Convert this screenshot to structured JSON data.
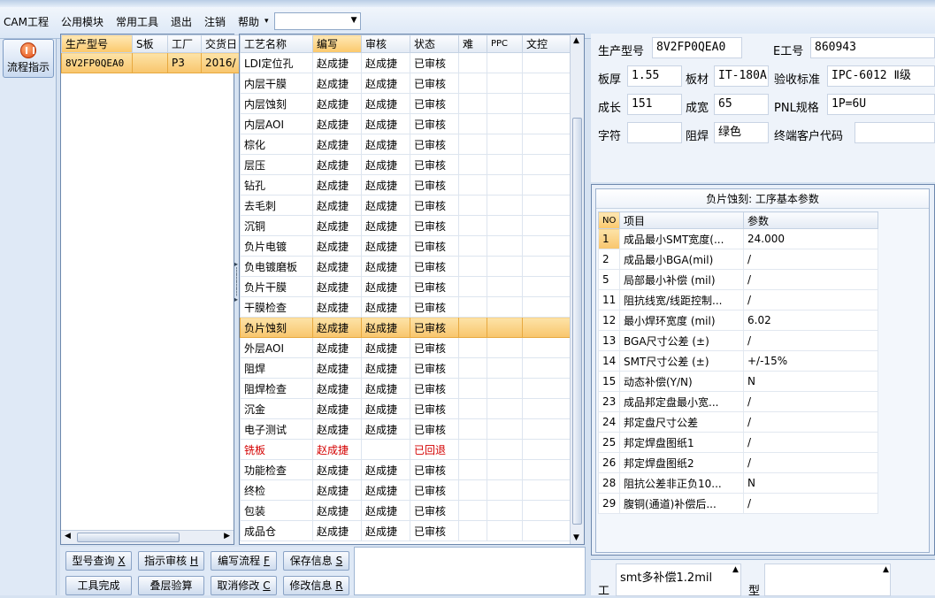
{
  "menu": {
    "items": [
      "CAM工程",
      "公用模块",
      "常用工具",
      "退出",
      "注销",
      "帮助"
    ],
    "help_arrow": "▾",
    "combo_value": ""
  },
  "sidebar": {
    "flow_button": "流程指示"
  },
  "orders": {
    "columns": [
      "生产型号",
      "S板",
      "工厂",
      "交货日"
    ],
    "rows": [
      {
        "model": "8V2FP0QEA0",
        "s": "",
        "factory": "P3",
        "date": "2016/"
      }
    ]
  },
  "process": {
    "columns": [
      "工艺名称",
      "编写",
      "审核",
      "状态",
      "难",
      "PPC",
      "文控"
    ],
    "rows": [
      {
        "name": "LDI定位孔",
        "writer": "赵成捷",
        "reviewer": "赵成捷",
        "status": "已审核"
      },
      {
        "name": "内层干膜",
        "writer": "赵成捷",
        "reviewer": "赵成捷",
        "status": "已审核"
      },
      {
        "name": "内层蚀刻",
        "writer": "赵成捷",
        "reviewer": "赵成捷",
        "status": "已审核"
      },
      {
        "name": "内层AOI",
        "writer": "赵成捷",
        "reviewer": "赵成捷",
        "status": "已审核"
      },
      {
        "name": "棕化",
        "writer": "赵成捷",
        "reviewer": "赵成捷",
        "status": "已审核"
      },
      {
        "name": "层压",
        "writer": "赵成捷",
        "reviewer": "赵成捷",
        "status": "已审核"
      },
      {
        "name": "钻孔",
        "writer": "赵成捷",
        "reviewer": "赵成捷",
        "status": "已审核"
      },
      {
        "name": "去毛刺",
        "writer": "赵成捷",
        "reviewer": "赵成捷",
        "status": "已审核"
      },
      {
        "name": "沉铜",
        "writer": "赵成捷",
        "reviewer": "赵成捷",
        "status": "已审核"
      },
      {
        "name": "负片电镀",
        "writer": "赵成捷",
        "reviewer": "赵成捷",
        "status": "已审核"
      },
      {
        "name": "负电镀磨板",
        "writer": "赵成捷",
        "reviewer": "赵成捷",
        "status": "已审核"
      },
      {
        "name": "负片干膜",
        "writer": "赵成捷",
        "reviewer": "赵成捷",
        "status": "已审核"
      },
      {
        "name": "干膜检查",
        "writer": "赵成捷",
        "reviewer": "赵成捷",
        "status": "已审核"
      },
      {
        "name": "负片蚀刻",
        "writer": "赵成捷",
        "reviewer": "赵成捷",
        "status": "已审核",
        "selected": true
      },
      {
        "name": "外层AOI",
        "writer": "赵成捷",
        "reviewer": "赵成捷",
        "status": "已审核"
      },
      {
        "name": "阻焊",
        "writer": "赵成捷",
        "reviewer": "赵成捷",
        "status": "已审核"
      },
      {
        "name": "阻焊检查",
        "writer": "赵成捷",
        "reviewer": "赵成捷",
        "status": "已审核"
      },
      {
        "name": "沉金",
        "writer": "赵成捷",
        "reviewer": "赵成捷",
        "status": "已审核"
      },
      {
        "name": "电子测试",
        "writer": "赵成捷",
        "reviewer": "赵成捷",
        "status": "已审核"
      },
      {
        "name": "铣板",
        "writer": "赵成捷",
        "reviewer": "",
        "status": "已回退",
        "returned": true
      },
      {
        "name": "功能检查",
        "writer": "赵成捷",
        "reviewer": "赵成捷",
        "status": "已审核"
      },
      {
        "name": "终检",
        "writer": "赵成捷",
        "reviewer": "赵成捷",
        "status": "已审核"
      },
      {
        "name": "包装",
        "writer": "赵成捷",
        "reviewer": "赵成捷",
        "status": "已审核"
      },
      {
        "name": "成品仓",
        "writer": "赵成捷",
        "reviewer": "赵成捷",
        "status": "已审核"
      }
    ]
  },
  "buttons": {
    "model_query": "型号查询",
    "model_query_key": "X",
    "guide_review": "指示审核",
    "guide_review_key": "H",
    "write_flow": "编写流程",
    "write_flow_key": "F",
    "save_info": "保存信息",
    "save_info_key": "S",
    "tool_done": "工具完成",
    "stack_check": "叠层验算",
    "cancel_edit": "取消修改",
    "cancel_edit_key": "C",
    "edit_info": "修改信息",
    "edit_info_key": "R"
  },
  "info": {
    "model_label": "生产型号",
    "model": "8V2FP0QEA0",
    "eno_label": "E工号",
    "eno": "860943",
    "thick_label": "板厚",
    "thick": "1.55",
    "material_label": "板材",
    "material": "IT-180A",
    "standard_label": "验收标准",
    "standard": "IPC-6012 Ⅱ级",
    "length_label": "成长",
    "length": "151",
    "width_label": "成宽",
    "width": "65",
    "pnl_label": "PNL规格",
    "pnl": "1P=6U",
    "char_label": "字符",
    "char": "",
    "mask_label": "阻焊",
    "mask": "绿色",
    "customer_label": "终端客户代码",
    "customer": ""
  },
  "params": {
    "title": "负片蚀刻: 工序基本参数",
    "columns": [
      "NO",
      "项目",
      "参数"
    ],
    "rows": [
      {
        "no": "1",
        "item": "成品最小SMT宽度(...",
        "value": "24.000"
      },
      {
        "no": "2",
        "item": "成品最小BGA(mil)",
        "value": "/"
      },
      {
        "no": "5",
        "item": "局部最小补偿 (mil)",
        "value": "/"
      },
      {
        "no": "11",
        "item": "阻抗线宽/线距控制...",
        "value": "/"
      },
      {
        "no": "12",
        "item": "最小焊环宽度 (mil)",
        "value": "6.02"
      },
      {
        "no": "13",
        "item": "BGA尺寸公差 (±)",
        "value": "/"
      },
      {
        "no": "14",
        "item": "SMT尺寸公差 (±)",
        "value": "+/-15%"
      },
      {
        "no": "15",
        "item": "动态补偿(Y/N)",
        "value": "N"
      },
      {
        "no": "23",
        "item": "成品邦定盘最小宽...",
        "value": "/"
      },
      {
        "no": "24",
        "item": "邦定盘尺寸公差",
        "value": "/"
      },
      {
        "no": "25",
        "item": "邦定焊盘图纸1",
        "value": "/"
      },
      {
        "no": "26",
        "item": "邦定焊盘图纸2",
        "value": "/"
      },
      {
        "no": "28",
        "item": "阻抗公差非正负10...",
        "value": "N"
      },
      {
        "no": "29",
        "item": "腹铜(通道)补偿后...",
        "value": "/"
      }
    ]
  },
  "notes": {
    "label_left": "工",
    "text": "smt多补偿1.2mil",
    "label_right": "型"
  }
}
